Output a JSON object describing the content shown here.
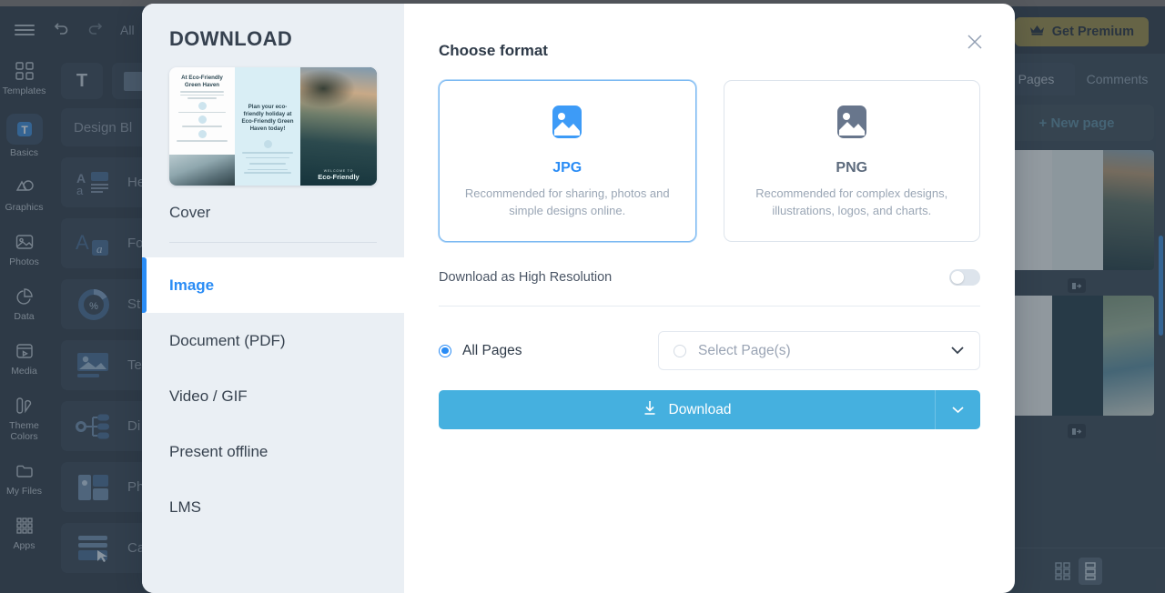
{
  "editor": {
    "topbar": {
      "menu_icon": "hamburger-icon",
      "undo_icon": "undo-icon",
      "redo_icon": "redo-icon",
      "autosave_label": "All",
      "premium_label": "Get Premium",
      "premium_icon": "crown-icon"
    },
    "rail": [
      {
        "label": "Templates",
        "icon": "templates-icon"
      },
      {
        "label": "Basics",
        "icon": "text-basics-icon"
      },
      {
        "label": "Graphics",
        "icon": "graphics-icon"
      },
      {
        "label": "Photos",
        "icon": "photos-icon"
      },
      {
        "label": "Data",
        "icon": "data-chart-icon"
      },
      {
        "label": "Media",
        "icon": "media-video-icon"
      },
      {
        "label": "Theme Colors",
        "icon": "theme-colors-icon"
      },
      {
        "label": "My Files",
        "icon": "folder-icon"
      },
      {
        "label": "Apps",
        "icon": "apps-grid-icon"
      }
    ],
    "elements_panel": {
      "tool_text": "T",
      "tool_shape": "shape-icon",
      "search_placeholder": "Design Bl",
      "rows": [
        {
          "label": "He",
          "icon": "headings-icon"
        },
        {
          "label": "Fo",
          "icon": "fonts-icon"
        },
        {
          "label": "St",
          "icon": "stats-icon"
        },
        {
          "label": "Te",
          "icon": "text-image-icon"
        },
        {
          "label": "Di",
          "icon": "diagram-icon"
        },
        {
          "label": "Ph",
          "icon": "photo-grid-icon"
        },
        {
          "label": "Ca",
          "icon": "cards-icon"
        }
      ]
    },
    "pages_panel": {
      "tabs": [
        {
          "label": "Pages",
          "active": true
        },
        {
          "label": "Comments",
          "active": false
        }
      ],
      "new_page_label": "+ New page",
      "layout_grid_icon": "grid-layout-icon",
      "layout_list_icon": "list-layout-icon"
    }
  },
  "modal": {
    "title": "DOWNLOAD",
    "close_icon": "close-icon",
    "preview_label": "Cover",
    "preview": {
      "panel1_title": "At Eco-Friendly Green Haven",
      "panel2_title": "Plan your eco-friendly holiday at Eco-Friendly Green Haven today!",
      "panel3_caption": "Eco-Friendly",
      "panel3_eyebrow": "WELCOME TO"
    },
    "format_menu": [
      {
        "label": "Image",
        "active": true
      },
      {
        "label": "Document (PDF)",
        "active": false
      },
      {
        "label": "Video / GIF",
        "active": false
      },
      {
        "label": "Present offline",
        "active": false
      },
      {
        "label": "LMS",
        "active": false
      }
    ],
    "choose_format_label": "Choose format",
    "format_cards": [
      {
        "name": "JPG",
        "description": "Recommended for sharing, photos and simple designs online.",
        "selected": true,
        "icon": "image-icon"
      },
      {
        "name": "PNG",
        "description": "Recommended for complex designs, illustrations, logos, and charts.",
        "selected": false,
        "icon": "image-icon"
      }
    ],
    "high_resolution": {
      "label": "Download as High Resolution",
      "enabled": false
    },
    "pages_option": {
      "all_pages_label": "All Pages",
      "all_pages_selected": true,
      "select_pages_placeholder": "Select Page(s)",
      "chevron_icon": "chevron-down-icon"
    },
    "download": {
      "label": "Download",
      "icon": "download-icon",
      "split_icon": "chevron-down-icon"
    }
  },
  "colors": {
    "accent_blue": "#2a8cf5",
    "download_btn": "#45b0df",
    "modal_left_bg": "#eaeff4",
    "editor_bg": "#33414f",
    "premium_gold": "#9a8c4e"
  }
}
